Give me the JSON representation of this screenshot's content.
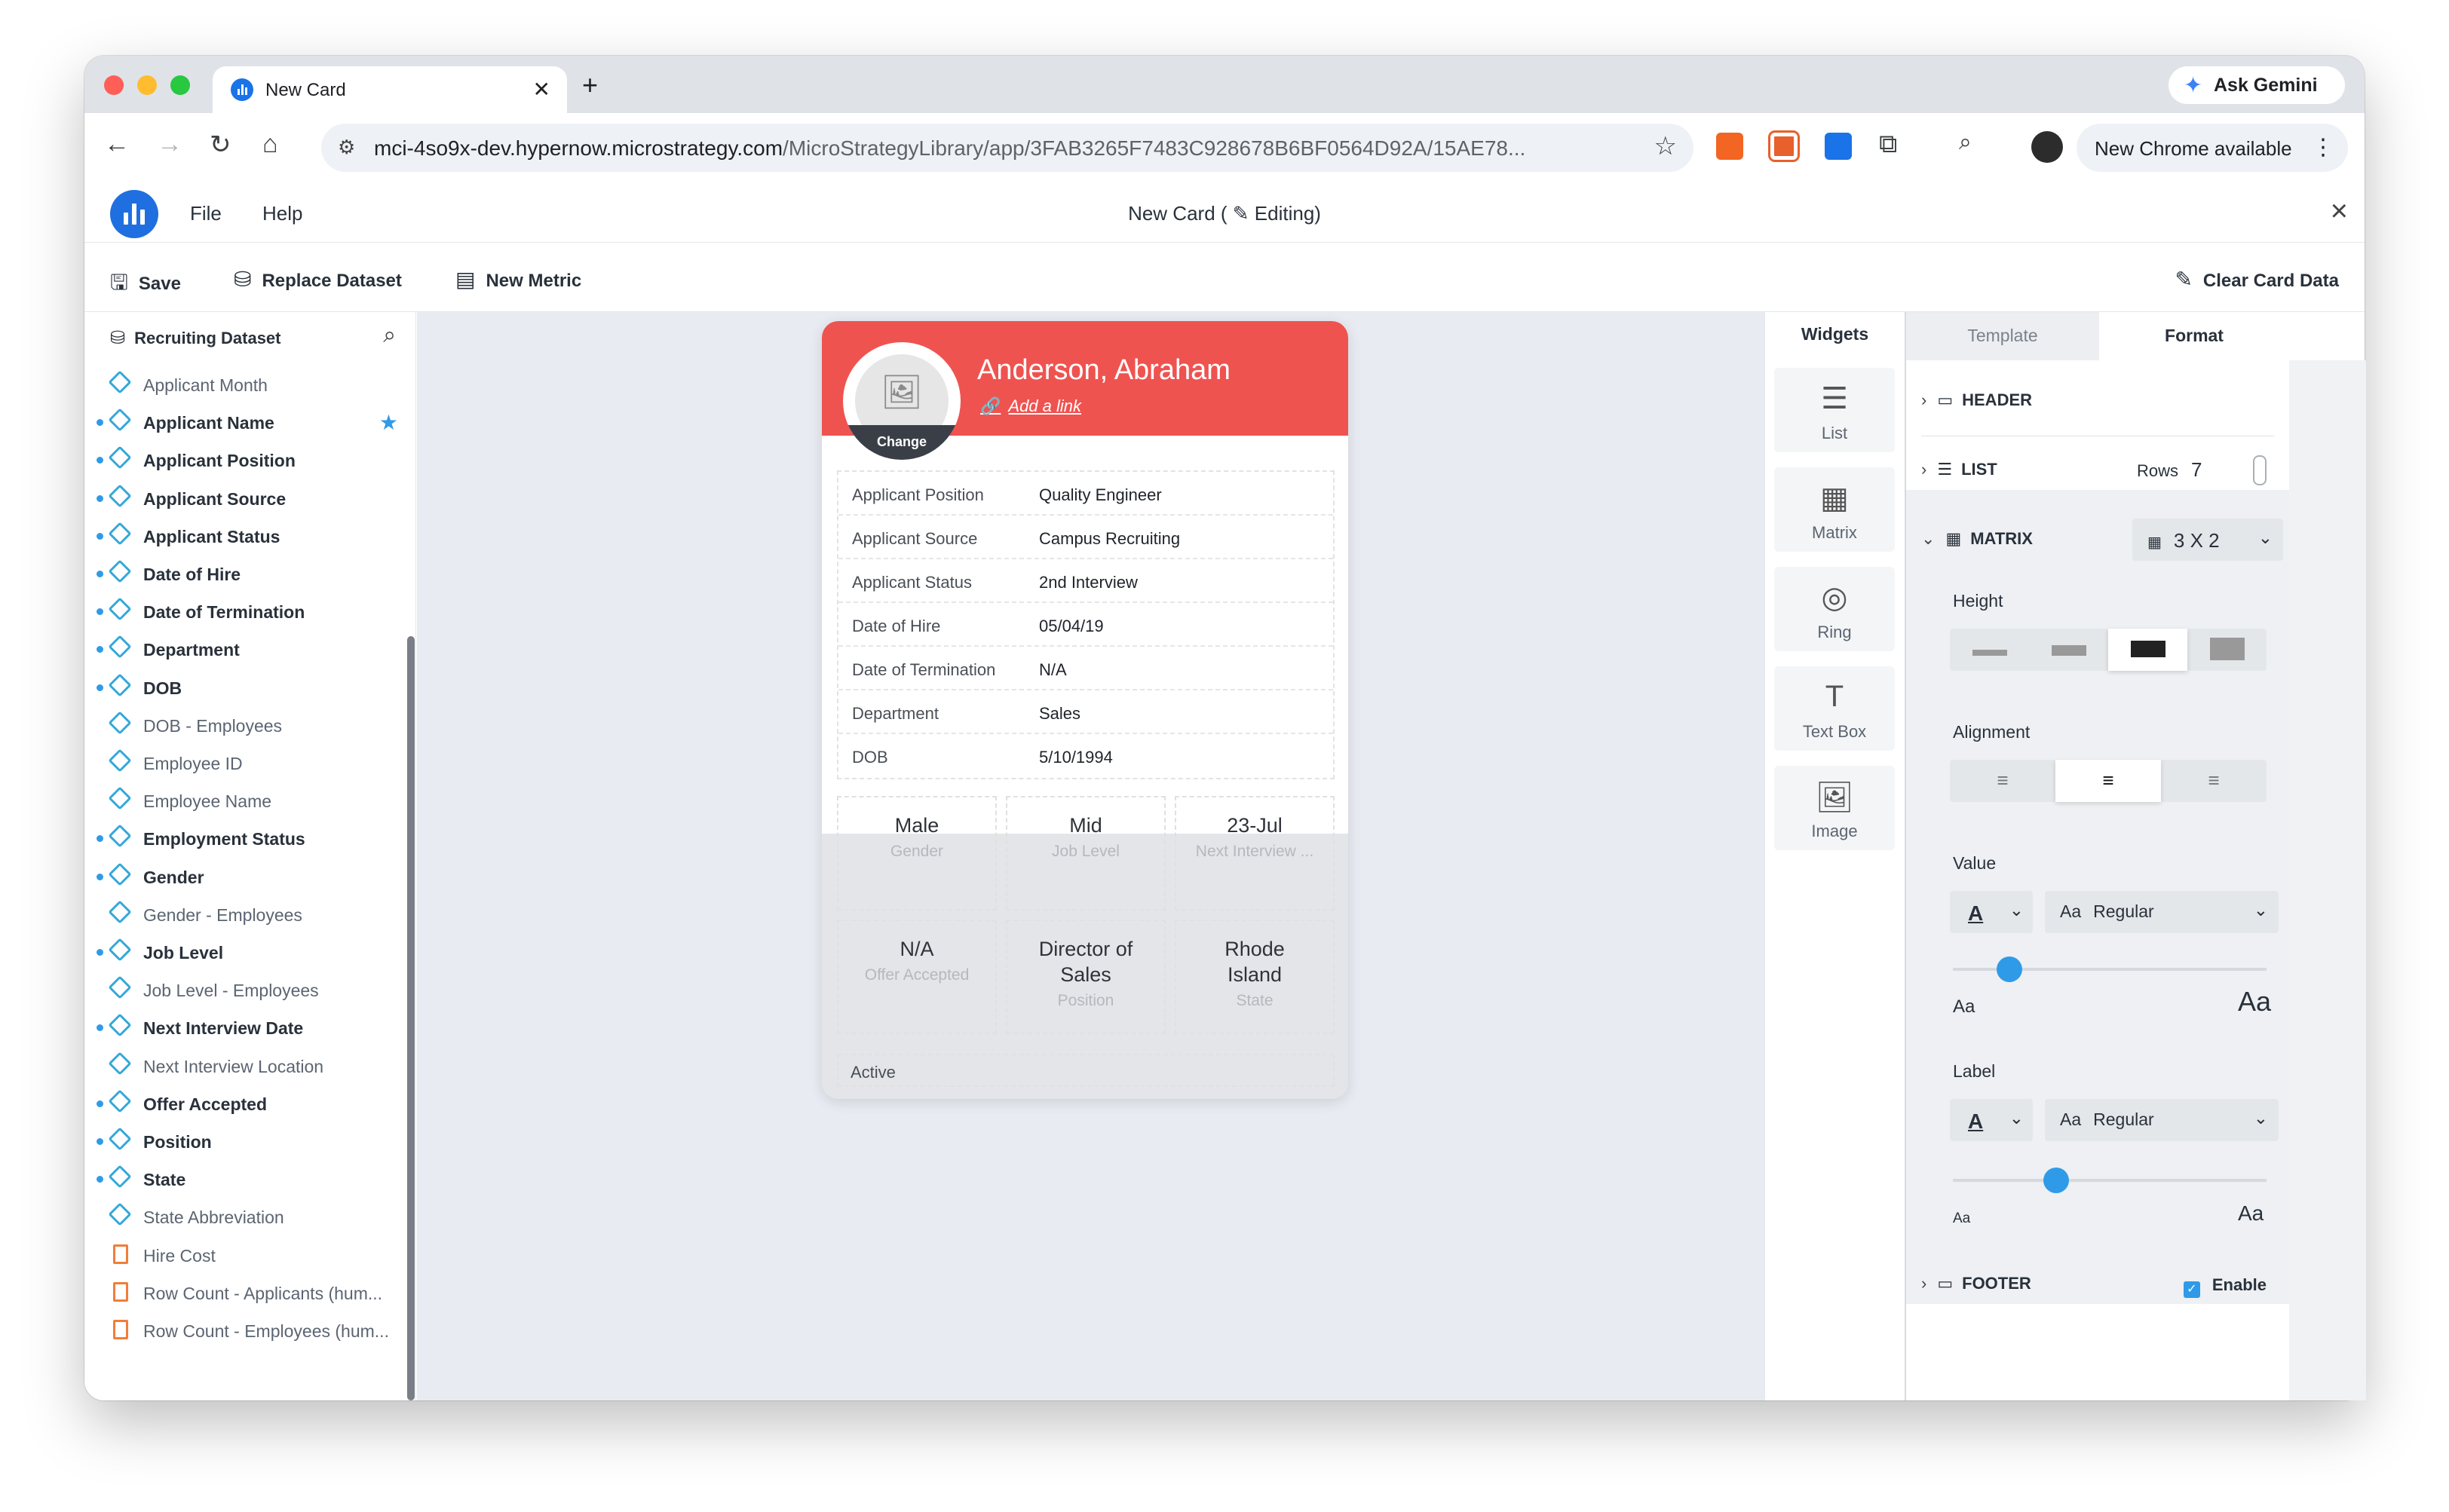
{
  "browser": {
    "tab_title": "New Card",
    "tab_close": "✕",
    "new_tab": "+",
    "gemini": "Ask Gemini",
    "url_host": "mci-4so9x-dev.hypernow.microstrategy.com",
    "url_path": "/MicroStrategyLibrary/app/3FAB3265F7483C928678B6BF0564D92A/15AE78...",
    "chrome_update": "New Chrome available"
  },
  "app": {
    "menu_file": "File",
    "menu_help": "Help",
    "title": "New Card",
    "editing": "( ✎ Editing)",
    "toolbar": {
      "save": "Save",
      "replace_dataset": "Replace Dataset",
      "new_metric": "New Metric",
      "clear_card_data": "Clear Card Data"
    }
  },
  "dataset": {
    "name": "Recruiting Dataset",
    "items": [
      {
        "label": "Applicant Month",
        "bold": false,
        "dot": false,
        "type": "attribute"
      },
      {
        "label": "Applicant Name",
        "bold": true,
        "dot": true,
        "type": "attribute",
        "starred": true
      },
      {
        "label": "Applicant Position",
        "bold": true,
        "dot": true,
        "type": "attribute"
      },
      {
        "label": "Applicant Source",
        "bold": true,
        "dot": true,
        "type": "attribute"
      },
      {
        "label": "Applicant Status",
        "bold": true,
        "dot": true,
        "type": "attribute"
      },
      {
        "label": "Date of Hire",
        "bold": true,
        "dot": true,
        "type": "attribute"
      },
      {
        "label": "Date of Termination",
        "bold": true,
        "dot": true,
        "type": "attribute"
      },
      {
        "label": "Department",
        "bold": true,
        "dot": true,
        "type": "attribute"
      },
      {
        "label": "DOB",
        "bold": true,
        "dot": true,
        "type": "attribute"
      },
      {
        "label": "DOB - Employees",
        "bold": false,
        "dot": false,
        "type": "attribute"
      },
      {
        "label": "Employee ID",
        "bold": false,
        "dot": false,
        "type": "attribute"
      },
      {
        "label": "Employee Name",
        "bold": false,
        "dot": false,
        "type": "attribute"
      },
      {
        "label": "Employment Status",
        "bold": true,
        "dot": true,
        "type": "attribute"
      },
      {
        "label": "Gender",
        "bold": true,
        "dot": true,
        "type": "attribute"
      },
      {
        "label": "Gender - Employees",
        "bold": false,
        "dot": false,
        "type": "attribute"
      },
      {
        "label": "Job Level",
        "bold": true,
        "dot": true,
        "type": "attribute"
      },
      {
        "label": "Job Level - Employees",
        "bold": false,
        "dot": false,
        "type": "attribute"
      },
      {
        "label": "Next Interview Date",
        "bold": true,
        "dot": true,
        "type": "attribute"
      },
      {
        "label": "Next Interview Location",
        "bold": false,
        "dot": false,
        "type": "attribute"
      },
      {
        "label": "Offer Accepted",
        "bold": true,
        "dot": true,
        "type": "attribute"
      },
      {
        "label": "Position",
        "bold": true,
        "dot": true,
        "type": "attribute"
      },
      {
        "label": "State",
        "bold": true,
        "dot": true,
        "type": "attribute"
      },
      {
        "label": "State Abbreviation",
        "bold": false,
        "dot": false,
        "type": "attribute"
      },
      {
        "label": "Hire Cost",
        "bold": false,
        "dot": false,
        "type": "metric"
      },
      {
        "label": "Row Count - Applicants (hum...",
        "bold": false,
        "dot": false,
        "type": "metric"
      },
      {
        "label": "Row Count - Employees (hum...",
        "bold": false,
        "dot": false,
        "type": "metric"
      }
    ]
  },
  "card": {
    "name": "Anderson, Abraham",
    "change": "Change",
    "add_link": "Add a link",
    "rows": [
      {
        "k": "Applicant Position",
        "v": "Quality Engineer"
      },
      {
        "k": "Applicant Source",
        "v": "Campus Recruiting"
      },
      {
        "k": "Applicant Status",
        "v": "2nd Interview"
      },
      {
        "k": "Date of Hire",
        "v": "05/04/19"
      },
      {
        "k": "Date of Termination",
        "v": "N/A"
      },
      {
        "k": "Department",
        "v": "Sales"
      },
      {
        "k": "DOB",
        "v": "5/10/1994"
      }
    ],
    "matrix": [
      {
        "v": "Male",
        "l": "Gender"
      },
      {
        "v": "Mid",
        "l": "Job Level"
      },
      {
        "v": "23-Jul",
        "l": "Next Interview ..."
      },
      {
        "v": "N/A",
        "l": "Offer Accepted"
      },
      {
        "v": "Director of Sales",
        "l": "Position"
      },
      {
        "v": "Rhode Island",
        "l": "State"
      }
    ],
    "footer": "Active"
  },
  "widgets": {
    "title": "Widgets",
    "items": [
      "List",
      "Matrix",
      "Ring",
      "Text Box",
      "Image"
    ]
  },
  "format": {
    "tab_template": "Template",
    "tab_format": "Format",
    "header": "HEADER",
    "list": "LIST",
    "rows_label": "Rows",
    "rows_value": "7",
    "matrix": "MATRIX",
    "matrix_size": "3 X 2",
    "height": "Height",
    "alignment": "Alignment",
    "value": "Value",
    "value_font": "Regular",
    "value_size_fraction": 0.18,
    "label": "Label",
    "label_font": "Regular",
    "label_size_fraction": 0.33,
    "aa": "Aa",
    "footer": "FOOTER",
    "enable": "Enable"
  }
}
